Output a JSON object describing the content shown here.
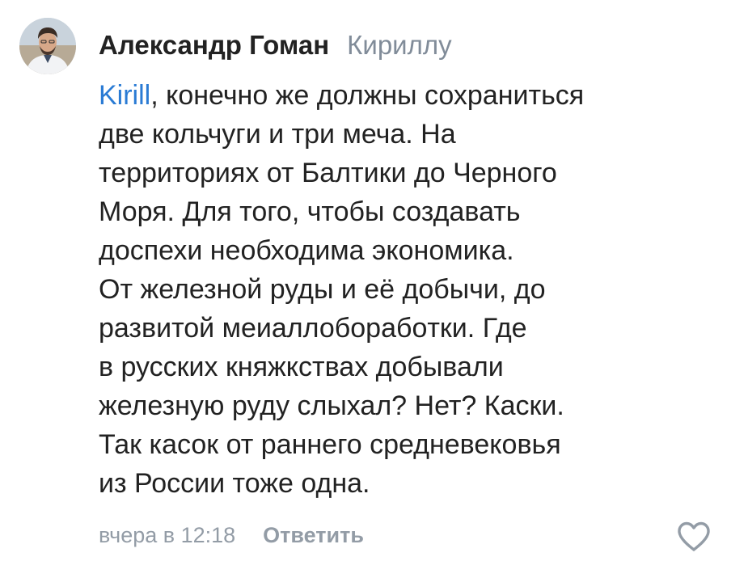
{
  "comment": {
    "author": "Александр Гоман",
    "reply_to": "Кириллу",
    "mention": "Kirill",
    "text_lines": [
      ", конечно же должны сохраниться",
      "две кольчуги и три меча. На",
      "территориях от Балтики до Черного",
      "Моря. Для того, чтобы создавать",
      "доспехи необходима экономика.",
      "От железной руды и её добычи, до",
      "развитой меиаллоборабoтки. Где",
      "в русских княжкствах добывали",
      "железную руду слыхал? Нет? Каски.",
      "Так касок от раннего средневековья",
      "из России тоже одна."
    ],
    "date": "вчера в 12:18",
    "reply_label": "Ответить",
    "icons": {
      "avatar": "avatar-photo",
      "like": "heart-icon"
    }
  },
  "colors": {
    "author": "#222222",
    "secondary": "#818c99",
    "mention": "#2a7bd4",
    "footer": "#939ca6"
  }
}
